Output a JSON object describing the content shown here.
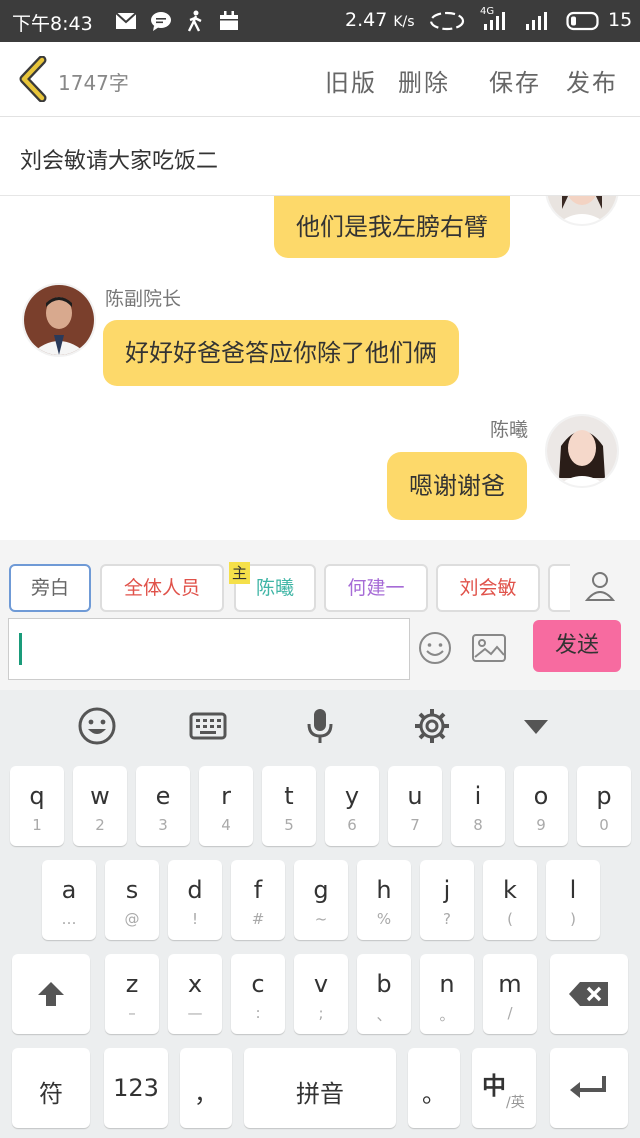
{
  "status_bar": {
    "time": "下午8:43",
    "speed_value": "2.47",
    "speed_unit": "K/s",
    "network": "4G",
    "battery": "15",
    "icons": [
      "mail-icon",
      "chat-icon",
      "walk-icon",
      "calendar-icon",
      "sync-icon",
      "signal-icon",
      "signal-icon",
      "battery-icon"
    ]
  },
  "title_bar": {
    "word_count": "1747字",
    "old_version": "旧版",
    "delete": "删除",
    "save": "保存",
    "publish": "发布"
  },
  "chapter": {
    "title": "刘会敏请大家吃饭二"
  },
  "messages": [
    {
      "sender": "",
      "side": "right",
      "text": "他们是我左膀右臂"
    },
    {
      "sender": "陈副院长",
      "side": "left",
      "text": "好好好爸爸答应你除了他们俩"
    },
    {
      "sender": "陈曦",
      "side": "right",
      "text": "嗯谢谢爸"
    }
  ],
  "roles": {
    "items": [
      "旁白",
      "全体人员",
      "陈曦",
      "何建一",
      "刘会敏"
    ],
    "selected": "旁白",
    "lead_badge": "主",
    "colors": [
      "#666666",
      "#e0524a",
      "#3fb5a5",
      "#a66bd6",
      "#e0524a"
    ]
  },
  "composer": {
    "value": "",
    "send_label": "发送"
  },
  "keyboard": {
    "toolbar": [
      "emoji-icon",
      "keyboard-icon",
      "mic-icon",
      "settings-icon",
      "collapse-icon"
    ],
    "row1": [
      [
        "q",
        "1"
      ],
      [
        "w",
        "2"
      ],
      [
        "e",
        "3"
      ],
      [
        "r",
        "4"
      ],
      [
        "t",
        "5"
      ],
      [
        "y",
        "6"
      ],
      [
        "u",
        "7"
      ],
      [
        "i",
        "8"
      ],
      [
        "o",
        "9"
      ],
      [
        "p",
        "0"
      ]
    ],
    "row2": [
      [
        "a",
        "…"
      ],
      [
        "s",
        "@"
      ],
      [
        "d",
        "!"
      ],
      [
        "f",
        "#"
      ],
      [
        "g",
        "~"
      ],
      [
        "h",
        "%"
      ],
      [
        "j",
        "?"
      ],
      [
        "k",
        "("
      ],
      [
        "l",
        ")"
      ]
    ],
    "row3": [
      [
        "z",
        "–"
      ],
      [
        "x",
        "—"
      ],
      [
        "c",
        ":"
      ],
      [
        "v",
        ";"
      ],
      [
        "b",
        "、"
      ],
      [
        "n",
        "。"
      ],
      [
        "m",
        "/"
      ]
    ],
    "bottom": {
      "symbols": "符",
      "numbers": "123",
      "comma": "，",
      "space": "拼音",
      "period": "。",
      "lang_main": "中",
      "lang_sub": "/英"
    }
  },
  "colors": {
    "bubble": "#fdd96a",
    "send": "#f76ba0",
    "status_bar": "#3c3c3c",
    "accent_back": "#e8c53a"
  }
}
